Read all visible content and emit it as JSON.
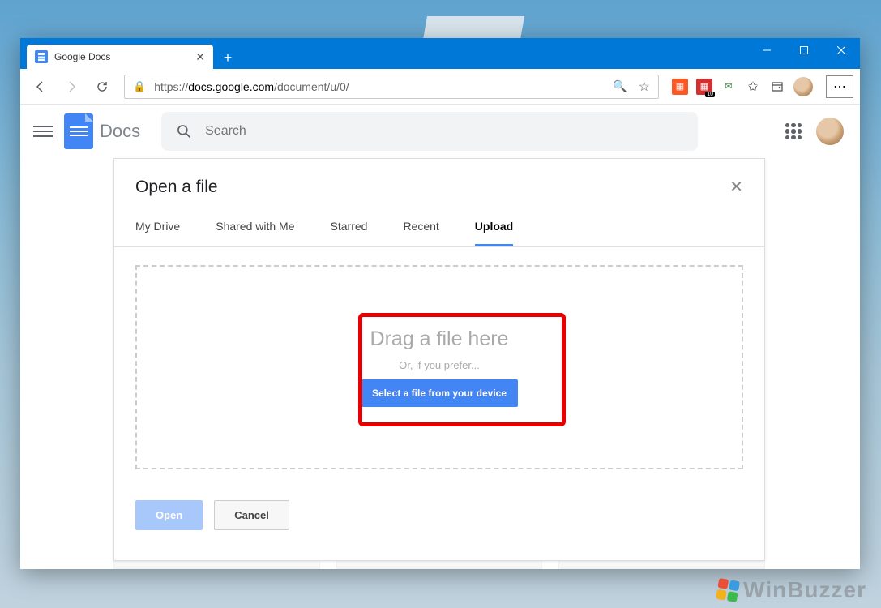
{
  "window": {
    "tab_title": "Google Docs",
    "url_display_prefix": "https://",
    "url_display_host": "docs.google.com",
    "url_display_path": "/document/u/0/"
  },
  "docs_header": {
    "app_name": "Docs",
    "search_placeholder": "Search"
  },
  "dialog": {
    "title": "Open a file",
    "tabs": [
      "My Drive",
      "Shared with Me",
      "Starred",
      "Recent",
      "Upload"
    ],
    "active_tab_index": 4,
    "drop_title": "Drag a file here",
    "drop_subtitle": "Or, if you prefer...",
    "select_button": "Select a file from your device",
    "open_button": "Open",
    "cancel_button": "Cancel"
  },
  "extension_badge": "10",
  "watermark": "WinBuzzer"
}
